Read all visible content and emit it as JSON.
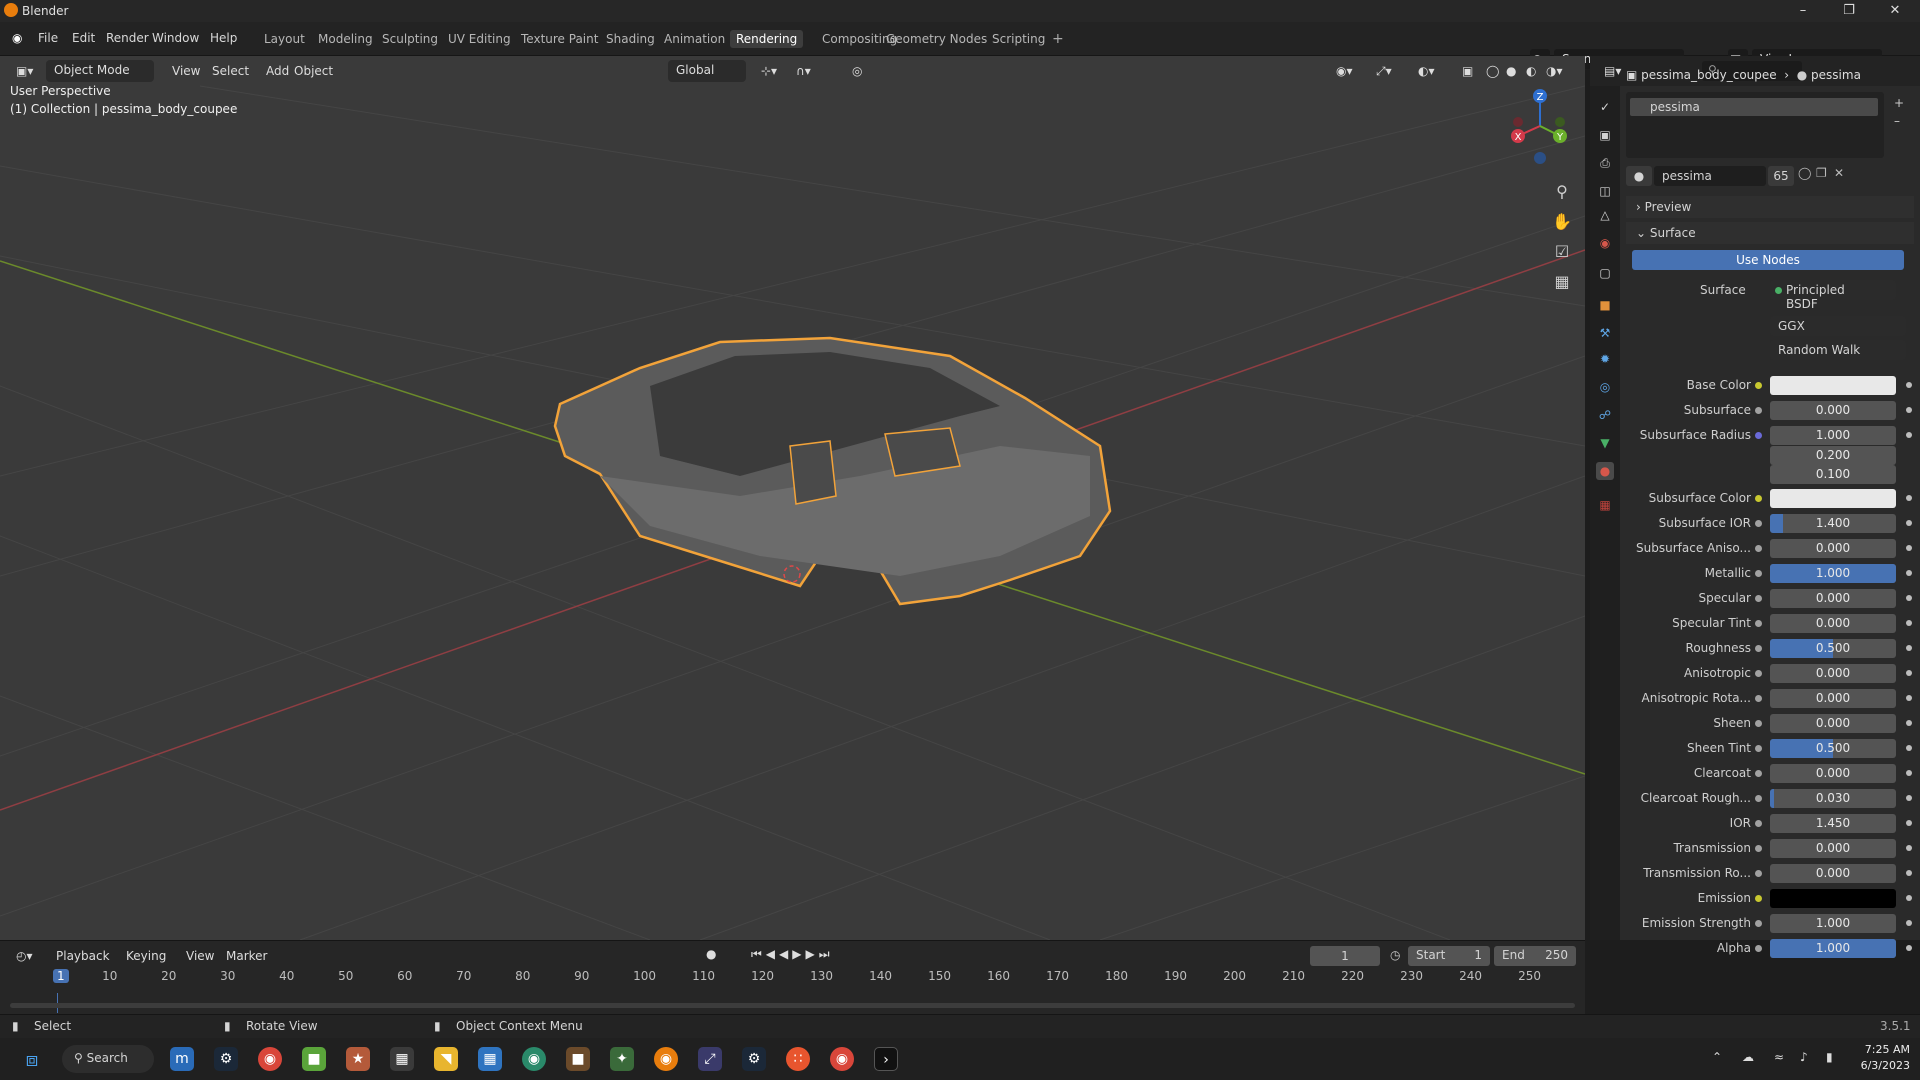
{
  "app": {
    "title": "Blender",
    "version": "3.5.1"
  },
  "menu": [
    "File",
    "Edit",
    "Render",
    "Window",
    "Help"
  ],
  "workspaces": [
    {
      "label": "Layout"
    },
    {
      "label": "Modeling"
    },
    {
      "label": "Sculpting"
    },
    {
      "label": "UV Editing"
    },
    {
      "label": "Texture Paint"
    },
    {
      "label": "Shading"
    },
    {
      "label": "Animation"
    },
    {
      "label": "Rendering",
      "active": true
    },
    {
      "label": "Compositing"
    },
    {
      "label": "Geometry Nodes"
    },
    {
      "label": "Scripting"
    }
  ],
  "scene": {
    "name": "Scene",
    "view_layer": "ViewLayer"
  },
  "viewport": {
    "mode": "Object Mode",
    "menus": [
      "View",
      "Select",
      "Add",
      "Object"
    ],
    "orientation": "Global",
    "overlay_title": "User Perspective",
    "overlay_collection": "(1) Collection | pessima_body_coupee",
    "gizmo": {
      "x": "X",
      "y": "Y",
      "z": "Z"
    }
  },
  "properties": {
    "breadcrumb_object": "pessima_body_coupee",
    "breadcrumb_material": "pessima",
    "slot_name": "pessima",
    "material_name": "pessima",
    "users": "65",
    "preview_label": "Preview",
    "surface_label": "Surface",
    "use_nodes": "Use Nodes",
    "surface_shader_label": "Surface",
    "surface_shader": "Principled BSDF",
    "distribution": "GGX",
    "subsurface_method": "Random Walk",
    "rows": [
      {
        "label": "Base Color",
        "type": "color",
        "color": "#e8e8e8",
        "dot": "#c8c830"
      },
      {
        "label": "Subsurface",
        "value": "0.000",
        "fill": 0
      },
      {
        "label": "Subsurface Radius",
        "value": "1.000",
        "fill": 0,
        "dot": "#6a6ad8"
      },
      {
        "label": "",
        "value": "0.200",
        "fill": 0,
        "nodot": true
      },
      {
        "label": "",
        "value": "0.100",
        "fill": 0,
        "nodot": true
      },
      {
        "label": "Subsurface Color",
        "type": "color",
        "color": "#e8e8e8",
        "dot": "#c8c830"
      },
      {
        "label": "Subsurface IOR",
        "value": "1.400",
        "fill": 0.1
      },
      {
        "label": "Subsurface Aniso...",
        "value": "0.000",
        "fill": 0
      },
      {
        "label": "Metallic",
        "value": "1.000",
        "fill": 1
      },
      {
        "label": "Specular",
        "value": "0.000",
        "fill": 0
      },
      {
        "label": "Specular Tint",
        "value": "0.000",
        "fill": 0
      },
      {
        "label": "Roughness",
        "value": "0.500",
        "fill": 0.5
      },
      {
        "label": "Anisotropic",
        "value": "0.000",
        "fill": 0
      },
      {
        "label": "Anisotropic Rota...",
        "value": "0.000",
        "fill": 0
      },
      {
        "label": "Sheen",
        "value": "0.000",
        "fill": 0
      },
      {
        "label": "Sheen Tint",
        "value": "0.500",
        "fill": 0.5
      },
      {
        "label": "Clearcoat",
        "value": "0.000",
        "fill": 0
      },
      {
        "label": "Clearcoat Rough...",
        "value": "0.030",
        "fill": 0.03
      },
      {
        "label": "IOR",
        "value": "1.450",
        "fill": 0
      },
      {
        "label": "Transmission",
        "value": "0.000",
        "fill": 0
      },
      {
        "label": "Transmission Ro...",
        "value": "0.000",
        "fill": 0
      },
      {
        "label": "Emission",
        "type": "color",
        "color": "#000000",
        "dot": "#c8c830"
      },
      {
        "label": "Emission Strength",
        "value": "1.000",
        "fill": 0
      },
      {
        "label": "Alpha",
        "value": "1.000",
        "fill": 1
      }
    ]
  },
  "timeline": {
    "menus": [
      "Playback",
      "Keying",
      "View",
      "Marker"
    ],
    "current_frame": "1",
    "start_label": "Start",
    "start": "1",
    "end_label": "End",
    "end": "250",
    "ticks": [
      "1",
      "10",
      "20",
      "30",
      "40",
      "50",
      "60",
      "70",
      "80",
      "90",
      "100",
      "110",
      "120",
      "130",
      "140",
      "150",
      "160",
      "170",
      "180",
      "190",
      "200",
      "210",
      "220",
      "230",
      "240",
      "250"
    ]
  },
  "status": {
    "select": "Select",
    "rotate": "Rotate View",
    "context": "Object Context Menu"
  },
  "taskbar": {
    "search": "Search",
    "time": "7:25 AM",
    "date": "6/3/2023"
  }
}
